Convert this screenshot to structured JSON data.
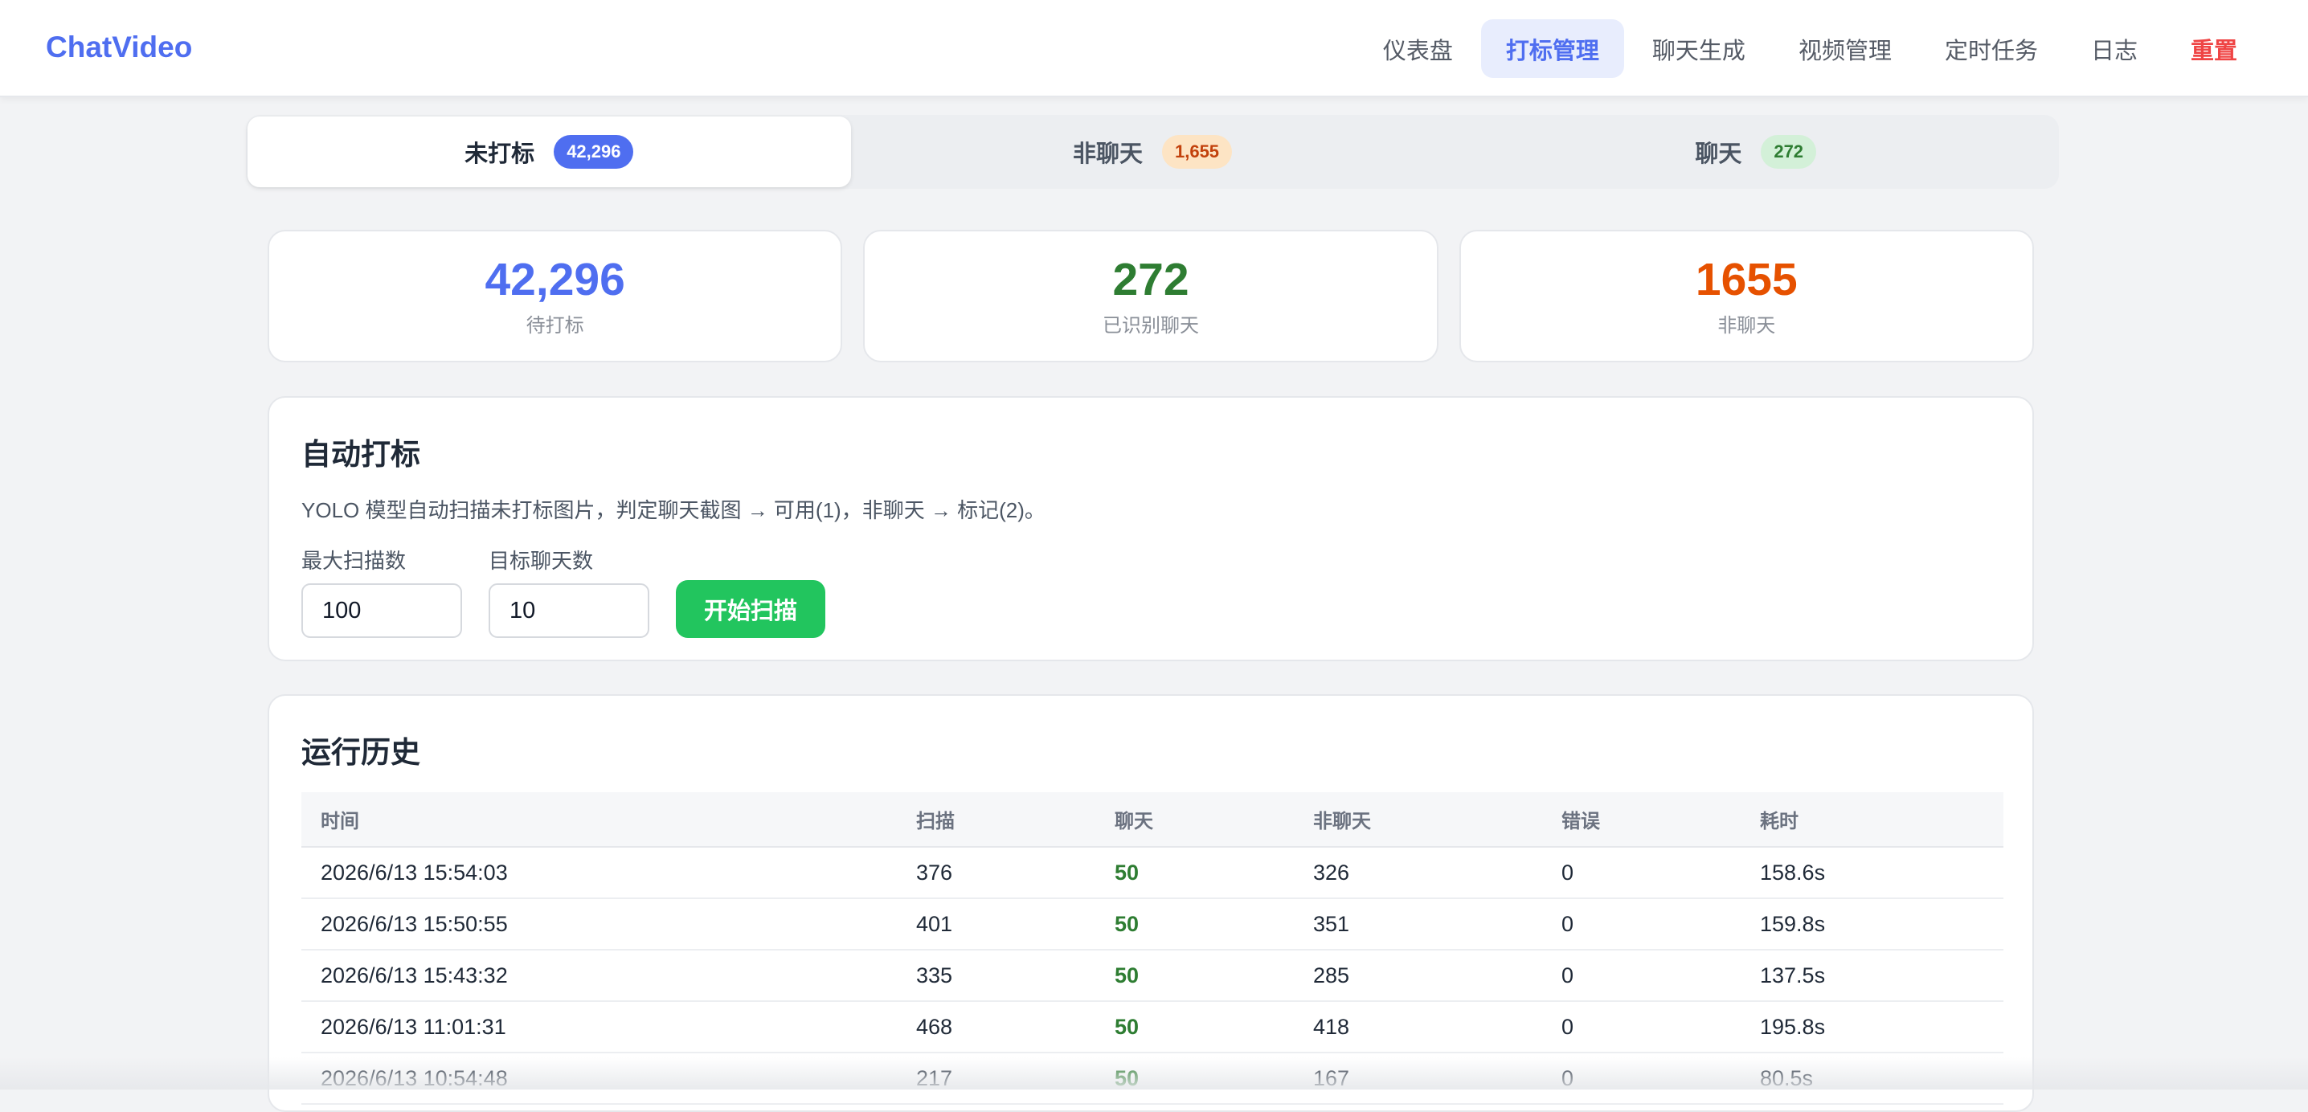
{
  "brand": "ChatVideo",
  "nav": [
    {
      "label": "仪表盘"
    },
    {
      "label": "打标管理"
    },
    {
      "label": "聊天生成"
    },
    {
      "label": "视频管理"
    },
    {
      "label": "定时任务"
    },
    {
      "label": "日志"
    },
    {
      "label": "重置"
    }
  ],
  "tabs": [
    {
      "label": "未打标",
      "count": "42,296"
    },
    {
      "label": "非聊天",
      "count": "1,655"
    },
    {
      "label": "聊天",
      "count": "272"
    }
  ],
  "stats": [
    {
      "value": "42,296",
      "label": "待打标",
      "color": "#4f6ef0"
    },
    {
      "value": "272",
      "label": "已识别聊天",
      "color": "#2e7d32"
    },
    {
      "value": "1655",
      "label": "非聊天",
      "color": "#e65100"
    }
  ],
  "auto": {
    "title": "自动打标",
    "description": "YOLO 模型自动扫描未打标图片，判定聊天截图 → 可用(1)，非聊天 → 标记(2)。",
    "max_scan_label": "最大扫描数",
    "max_scan_value": "100",
    "target_chat_label": "目标聊天数",
    "target_chat_value": "10",
    "start_button": "开始扫描"
  },
  "history": {
    "title": "运行历史",
    "columns": [
      "时间",
      "扫描",
      "聊天",
      "非聊天",
      "错误",
      "耗时"
    ],
    "rows": [
      [
        "2026/6/13 15:54:03",
        "376",
        "50",
        "326",
        "0",
        "158.6s"
      ],
      [
        "2026/6/13 15:50:55",
        "401",
        "50",
        "351",
        "0",
        "159.8s"
      ],
      [
        "2026/6/13 15:43:32",
        "335",
        "50",
        "285",
        "0",
        "137.5s"
      ],
      [
        "2026/6/13 11:01:31",
        "468",
        "50",
        "418",
        "0",
        "195.8s"
      ],
      [
        "2026/6/13 10:54:48",
        "217",
        "50",
        "167",
        "0",
        "80.5s"
      ]
    ]
  }
}
